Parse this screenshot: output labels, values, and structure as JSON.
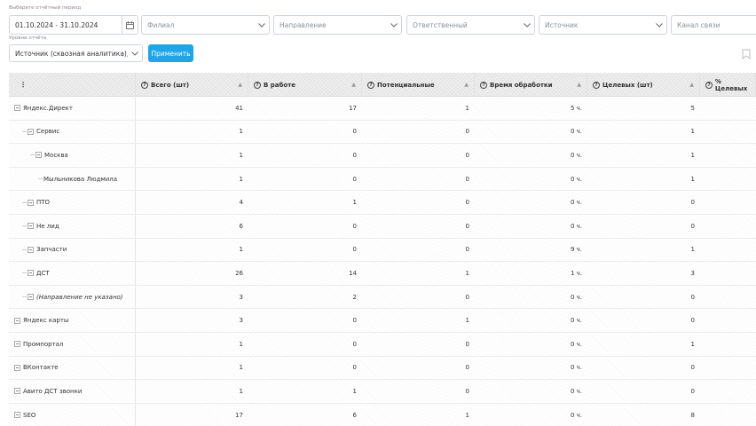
{
  "filters": {
    "period_caption": "Выберите отчётный период",
    "period_value": "01.10.2024 - 31.10.2024",
    "branch_placeholder": "Филиал",
    "direction_placeholder": "Направление",
    "responsible_placeholder": "Ответственный",
    "source_placeholder": "Источник",
    "channel_placeholder": "Канал связи",
    "levels_caption": "Уровни отчёта",
    "levels_value": "Источник (сквозная аналитика), Нап",
    "apply_label": "Применить"
  },
  "table": {
    "columns": [
      {
        "label": "",
        "help": false
      },
      {
        "label": "Всего (шт)",
        "help": true
      },
      {
        "label": "В работе",
        "help": true
      },
      {
        "label": "Потенциальные",
        "help": true
      },
      {
        "label": "Время обработки",
        "help": true
      },
      {
        "label": "Целевых (шт)",
        "help": true
      },
      {
        "label": "% Целевых",
        "help": true
      }
    ],
    "rows": [
      {
        "level": 0,
        "label": "Яндекс.Директ",
        "italic": false,
        "total": "41",
        "in_work": "17",
        "potential": "1",
        "time": "5 ч.",
        "target": "5"
      },
      {
        "level": 1,
        "label": "Сервис",
        "italic": false,
        "total": "1",
        "in_work": "0",
        "potential": "0",
        "time": "0 ч.",
        "target": "1"
      },
      {
        "level": 2,
        "label": "Москва",
        "italic": false,
        "total": "1",
        "in_work": "0",
        "potential": "0",
        "time": "0 ч.",
        "target": "1"
      },
      {
        "level": 3,
        "label": "Мыльникова Людмила",
        "italic": false,
        "total": "1",
        "in_work": "0",
        "potential": "0",
        "time": "0 ч.",
        "target": "1"
      },
      {
        "level": 1,
        "label": "ПТО",
        "italic": false,
        "total": "4",
        "in_work": "1",
        "potential": "0",
        "time": "0 ч.",
        "target": "0"
      },
      {
        "level": 1,
        "label": "Не лид",
        "italic": false,
        "total": "6",
        "in_work": "0",
        "potential": "0",
        "time": "0 ч.",
        "target": "0"
      },
      {
        "level": 1,
        "label": "Запчасти",
        "italic": false,
        "total": "1",
        "in_work": "0",
        "potential": "0",
        "time": "9 ч.",
        "target": "1"
      },
      {
        "level": 1,
        "label": "ДСТ",
        "italic": false,
        "total": "26",
        "in_work": "14",
        "potential": "1",
        "time": "1 ч.",
        "target": "3"
      },
      {
        "level": 1,
        "label": "(Направление не указано)",
        "italic": true,
        "total": "3",
        "in_work": "2",
        "potential": "0",
        "time": "0 ч.",
        "target": "0"
      },
      {
        "level": 0,
        "label": "Яндекс карты",
        "italic": false,
        "total": "3",
        "in_work": "0",
        "potential": "1",
        "time": "0 ч.",
        "target": "0"
      },
      {
        "level": 0,
        "label": "Промпортал",
        "italic": false,
        "total": "1",
        "in_work": "0",
        "potential": "0",
        "time": "0 ч.",
        "target": "1"
      },
      {
        "level": 0,
        "label": "ВКонтакте",
        "italic": false,
        "total": "1",
        "in_work": "0",
        "potential": "0",
        "time": "0 ч.",
        "target": "0"
      },
      {
        "level": 0,
        "label": "Авито ДСТ звонки",
        "italic": false,
        "total": "1",
        "in_work": "1",
        "potential": "0",
        "time": "0 ч.",
        "target": "0"
      },
      {
        "level": 0,
        "label": "SEO",
        "italic": false,
        "total": "17",
        "in_work": "6",
        "potential": "1",
        "time": "0 ч.",
        "target": "8"
      }
    ]
  }
}
